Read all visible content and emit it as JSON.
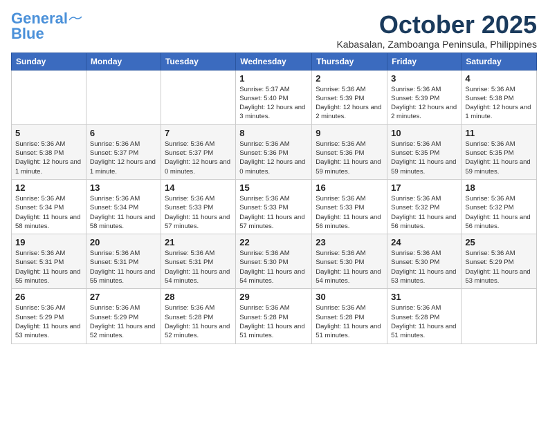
{
  "logo": {
    "line1": "General",
    "line2": "Blue"
  },
  "title": "October 2025",
  "subtitle": "Kabasalan, Zamboanga Peninsula, Philippines",
  "days_of_week": [
    "Sunday",
    "Monday",
    "Tuesday",
    "Wednesday",
    "Thursday",
    "Friday",
    "Saturday"
  ],
  "weeks": [
    [
      {
        "day": "",
        "info": ""
      },
      {
        "day": "",
        "info": ""
      },
      {
        "day": "",
        "info": ""
      },
      {
        "day": "1",
        "info": "Sunrise: 5:37 AM\nSunset: 5:40 PM\nDaylight: 12 hours and 3 minutes."
      },
      {
        "day": "2",
        "info": "Sunrise: 5:36 AM\nSunset: 5:39 PM\nDaylight: 12 hours and 2 minutes."
      },
      {
        "day": "3",
        "info": "Sunrise: 5:36 AM\nSunset: 5:39 PM\nDaylight: 12 hours and 2 minutes."
      },
      {
        "day": "4",
        "info": "Sunrise: 5:36 AM\nSunset: 5:38 PM\nDaylight: 12 hours and 1 minute."
      }
    ],
    [
      {
        "day": "5",
        "info": "Sunrise: 5:36 AM\nSunset: 5:38 PM\nDaylight: 12 hours and 1 minute."
      },
      {
        "day": "6",
        "info": "Sunrise: 5:36 AM\nSunset: 5:37 PM\nDaylight: 12 hours and 1 minute."
      },
      {
        "day": "7",
        "info": "Sunrise: 5:36 AM\nSunset: 5:37 PM\nDaylight: 12 hours and 0 minutes."
      },
      {
        "day": "8",
        "info": "Sunrise: 5:36 AM\nSunset: 5:36 PM\nDaylight: 12 hours and 0 minutes."
      },
      {
        "day": "9",
        "info": "Sunrise: 5:36 AM\nSunset: 5:36 PM\nDaylight: 11 hours and 59 minutes."
      },
      {
        "day": "10",
        "info": "Sunrise: 5:36 AM\nSunset: 5:35 PM\nDaylight: 11 hours and 59 minutes."
      },
      {
        "day": "11",
        "info": "Sunrise: 5:36 AM\nSunset: 5:35 PM\nDaylight: 11 hours and 59 minutes."
      }
    ],
    [
      {
        "day": "12",
        "info": "Sunrise: 5:36 AM\nSunset: 5:34 PM\nDaylight: 11 hours and 58 minutes."
      },
      {
        "day": "13",
        "info": "Sunrise: 5:36 AM\nSunset: 5:34 PM\nDaylight: 11 hours and 58 minutes."
      },
      {
        "day": "14",
        "info": "Sunrise: 5:36 AM\nSunset: 5:33 PM\nDaylight: 11 hours and 57 minutes."
      },
      {
        "day": "15",
        "info": "Sunrise: 5:36 AM\nSunset: 5:33 PM\nDaylight: 11 hours and 57 minutes."
      },
      {
        "day": "16",
        "info": "Sunrise: 5:36 AM\nSunset: 5:33 PM\nDaylight: 11 hours and 56 minutes."
      },
      {
        "day": "17",
        "info": "Sunrise: 5:36 AM\nSunset: 5:32 PM\nDaylight: 11 hours and 56 minutes."
      },
      {
        "day": "18",
        "info": "Sunrise: 5:36 AM\nSunset: 5:32 PM\nDaylight: 11 hours and 56 minutes."
      }
    ],
    [
      {
        "day": "19",
        "info": "Sunrise: 5:36 AM\nSunset: 5:31 PM\nDaylight: 11 hours and 55 minutes."
      },
      {
        "day": "20",
        "info": "Sunrise: 5:36 AM\nSunset: 5:31 PM\nDaylight: 11 hours and 55 minutes."
      },
      {
        "day": "21",
        "info": "Sunrise: 5:36 AM\nSunset: 5:31 PM\nDaylight: 11 hours and 54 minutes."
      },
      {
        "day": "22",
        "info": "Sunrise: 5:36 AM\nSunset: 5:30 PM\nDaylight: 11 hours and 54 minutes."
      },
      {
        "day": "23",
        "info": "Sunrise: 5:36 AM\nSunset: 5:30 PM\nDaylight: 11 hours and 54 minutes."
      },
      {
        "day": "24",
        "info": "Sunrise: 5:36 AM\nSunset: 5:30 PM\nDaylight: 11 hours and 53 minutes."
      },
      {
        "day": "25",
        "info": "Sunrise: 5:36 AM\nSunset: 5:29 PM\nDaylight: 11 hours and 53 minutes."
      }
    ],
    [
      {
        "day": "26",
        "info": "Sunrise: 5:36 AM\nSunset: 5:29 PM\nDaylight: 11 hours and 53 minutes."
      },
      {
        "day": "27",
        "info": "Sunrise: 5:36 AM\nSunset: 5:29 PM\nDaylight: 11 hours and 52 minutes."
      },
      {
        "day": "28",
        "info": "Sunrise: 5:36 AM\nSunset: 5:28 PM\nDaylight: 11 hours and 52 minutes."
      },
      {
        "day": "29",
        "info": "Sunrise: 5:36 AM\nSunset: 5:28 PM\nDaylight: 11 hours and 51 minutes."
      },
      {
        "day": "30",
        "info": "Sunrise: 5:36 AM\nSunset: 5:28 PM\nDaylight: 11 hours and 51 minutes."
      },
      {
        "day": "31",
        "info": "Sunrise: 5:36 AM\nSunset: 5:28 PM\nDaylight: 11 hours and 51 minutes."
      },
      {
        "day": "",
        "info": ""
      }
    ]
  ]
}
